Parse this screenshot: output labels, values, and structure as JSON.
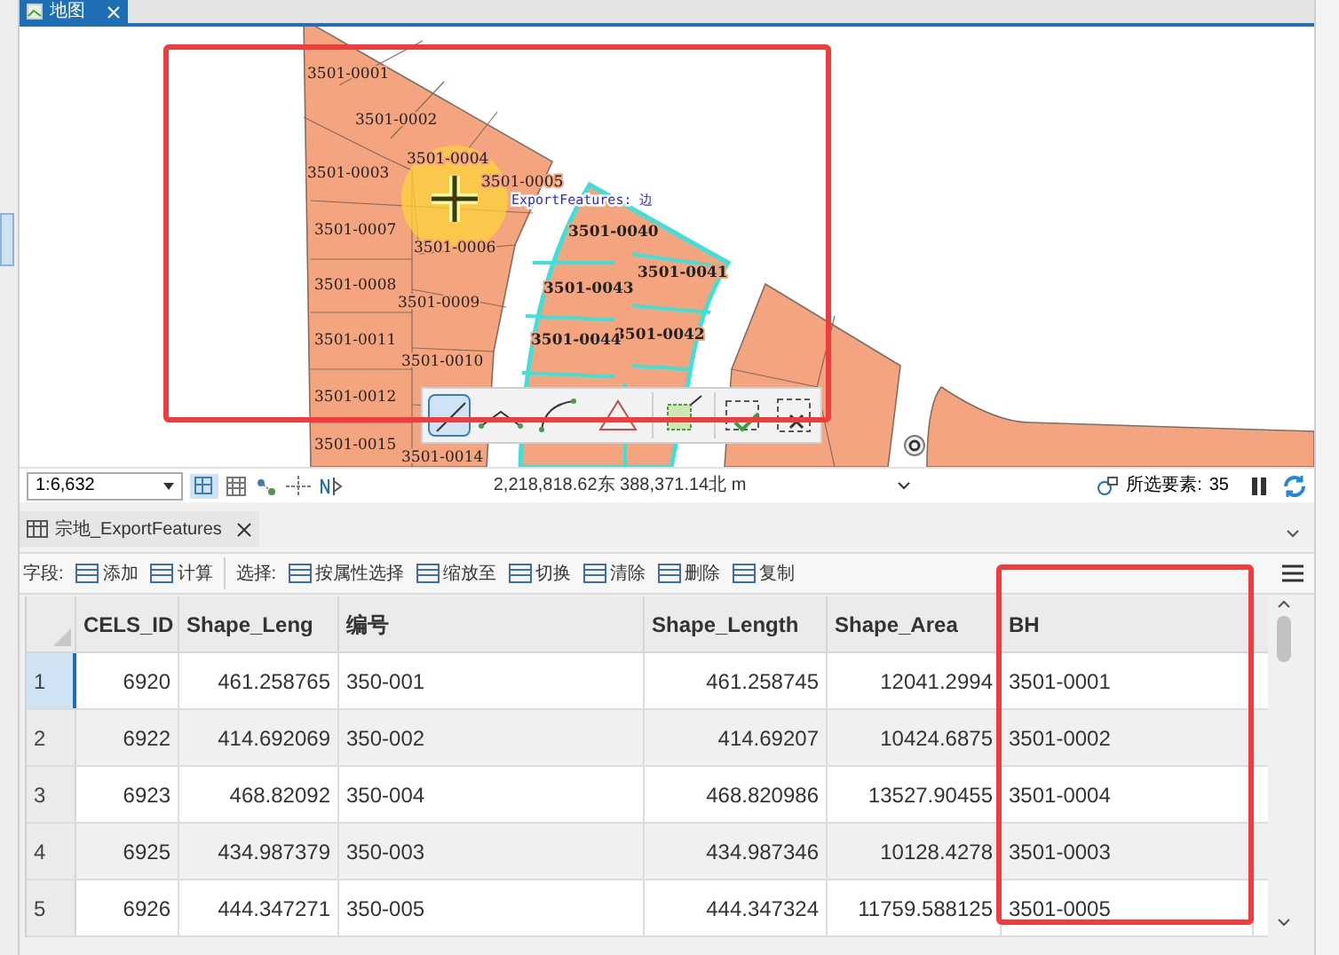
{
  "map_tab": {
    "title": "地图",
    "selected": true
  },
  "map": {
    "tooltip": "ExportFeatures: 边",
    "parcels": [
      {
        "label": "3501-0001",
        "highlighted": false
      },
      {
        "label": "3501-0002",
        "highlighted": false
      },
      {
        "label": "3501-0003",
        "highlighted": false
      },
      {
        "label": "3501-0004",
        "highlighted": false
      },
      {
        "label": "3501-0005",
        "highlighted": false
      },
      {
        "label": "3501-0007",
        "highlighted": false
      },
      {
        "label": "3501-0006",
        "highlighted": false
      },
      {
        "label": "3501-0008",
        "highlighted": false
      },
      {
        "label": "3501-0009",
        "highlighted": false
      },
      {
        "label": "3501-0011",
        "highlighted": false
      },
      {
        "label": "3501-0010",
        "highlighted": false
      },
      {
        "label": "3501-0012",
        "highlighted": false
      },
      {
        "label": "3501-0015",
        "highlighted": false
      },
      {
        "label": "3501-0014",
        "highlighted": false
      },
      {
        "label": "3501-0040",
        "highlighted": true
      },
      {
        "label": "3501-0041",
        "highlighted": true
      },
      {
        "label": "3501-0043",
        "highlighted": true
      },
      {
        "label": "3501-0042",
        "highlighted": true
      },
      {
        "label": "3501-0044",
        "highlighted": true
      }
    ]
  },
  "map_status": {
    "scale": "1:6,632",
    "coordinates": "2,218,818.62东 388,371.14北 m",
    "selected_label": "所选要素:",
    "selected_count": "35"
  },
  "table_tab": {
    "title": "宗地_ExportFeatures"
  },
  "toolbar": {
    "field_label": "字段:",
    "field_buttons": [
      "添加",
      "计算"
    ],
    "selection_label": "选择:",
    "selection_buttons": [
      "按属性选择",
      "缩放至",
      "切换",
      "清除",
      "删除",
      "复制"
    ]
  },
  "table": {
    "columns": [
      {
        "label": "CELS_ID",
        "kind": "number"
      },
      {
        "label": "Shape_Leng",
        "kind": "number"
      },
      {
        "label": "编号",
        "kind": "text"
      },
      {
        "label": "Shape_Length",
        "kind": "number"
      },
      {
        "label": "Shape_Area",
        "kind": "number"
      },
      {
        "label": "BH",
        "kind": "text"
      }
    ],
    "rows": [
      {
        "index": "1",
        "selected": true,
        "cells": [
          "6920",
          "461.258765",
          "350-001",
          "461.258745",
          "12041.2994",
          "3501-0001"
        ]
      },
      {
        "index": "2",
        "selected": false,
        "cells": [
          "6922",
          "414.692069",
          "350-002",
          "414.69207",
          "10424.6875",
          "3501-0002"
        ]
      },
      {
        "index": "3",
        "selected": false,
        "cells": [
          "6923",
          "468.82092",
          "350-004",
          "468.820986",
          "13527.90455",
          "3501-0004"
        ]
      },
      {
        "index": "4",
        "selected": false,
        "cells": [
          "6925",
          "434.987379",
          "350-003",
          "434.987346",
          "10128.4278",
          "3501-0003"
        ]
      },
      {
        "index": "5",
        "selected": false,
        "cells": [
          "6926",
          "444.347271",
          "350-005",
          "444.347324",
          "11759.588125",
          "3501-0005"
        ]
      }
    ]
  }
}
